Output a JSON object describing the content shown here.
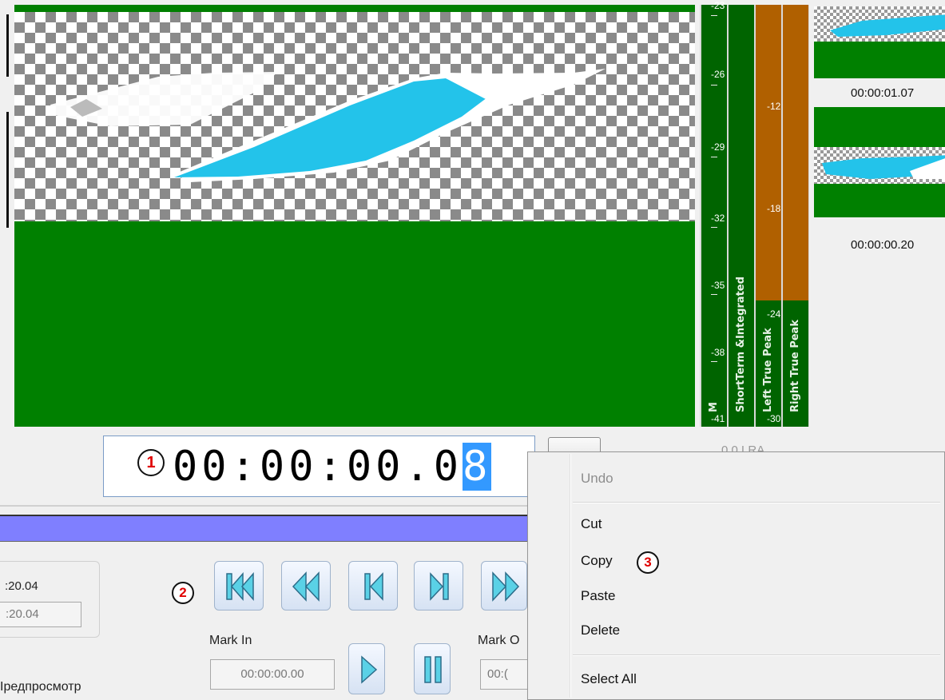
{
  "player": {
    "timecode_prefix": "00:00:00.0",
    "timecode_selected": "8",
    "loudness_readout": "0.0 LRA"
  },
  "meters": {
    "momentary_label": "M",
    "shortterm_label": "ShortTerm &Integrated",
    "left_peak_label": "Left True Peak",
    "right_peak_label": "Right True Peak",
    "loudness_scale": [
      "-23",
      "-26",
      "-29",
      "-32",
      "-35",
      "-38",
      "-41"
    ],
    "peak_scale": [
      "-12",
      "-18",
      "-24",
      "-30"
    ],
    "peak_level_fraction": 0.7
  },
  "thumbnails": [
    {
      "timecode": "00:00:01.07"
    },
    {
      "timecode": "00:00:00.20"
    }
  ],
  "durations": {
    "value_top": ":20.04",
    "value_bottom": ":20.04"
  },
  "transport": {
    "buttons": [
      "go-to-start",
      "rewind",
      "step-back",
      "step-forward",
      "fast-forward",
      "play",
      "pause"
    ]
  },
  "marks": {
    "mark_in_label": "Mark In",
    "mark_in_value": "00:00:00.00",
    "mark_out_label": "Mark O",
    "mark_out_value": "00:("
  },
  "preview_label": "Iредпросмотр",
  "annotations": {
    "one": "1",
    "two": "2",
    "three": "3"
  },
  "context_menu": {
    "undo": "Undo",
    "cut": "Cut",
    "copy": "Copy",
    "paste": "Paste",
    "delete": "Delete",
    "select_all": "Select All"
  },
  "colors": {
    "video_green": "#008000",
    "peak_orange": "#b06000",
    "meter_green": "#006400",
    "progress_blue": "#7f7fff",
    "selection_blue": "#3399ff"
  }
}
